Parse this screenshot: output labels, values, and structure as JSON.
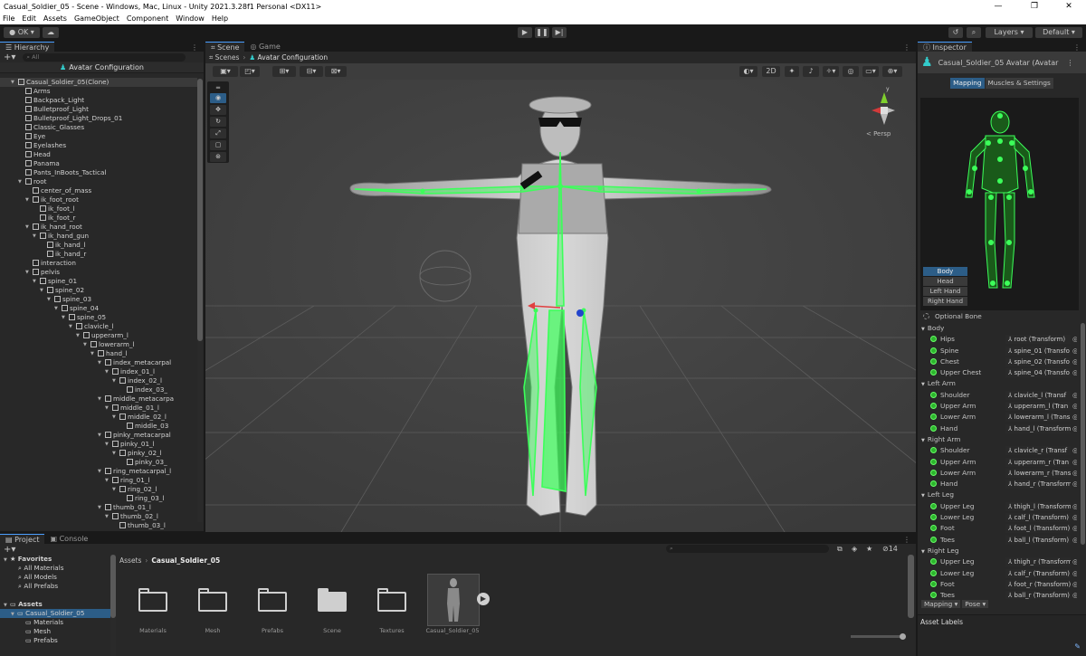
{
  "window": {
    "title": "Casual_Soldier_05 - Scene - Windows, Mac, Linux - Unity 2021.3.28f1 Personal <DX11>",
    "controls": [
      "—",
      "❐",
      "✕"
    ]
  },
  "menu": [
    "File",
    "Edit",
    "Assets",
    "GameObject",
    "Component",
    "Window",
    "Help"
  ],
  "toolbar": {
    "account": "OK",
    "layers": "Layers",
    "layout": "Default"
  },
  "hierarchy": {
    "tab": "Hierarchy",
    "search_placeholder": "All",
    "header": "Avatar Configuration",
    "items": [
      {
        "label": "Casual_Soldier_05(Clone)",
        "depth": 0,
        "fold": "▼"
      },
      {
        "label": "Arms",
        "depth": 1,
        "fold": ""
      },
      {
        "label": "Backpack_Light",
        "depth": 1,
        "fold": ""
      },
      {
        "label": "Bulletproof_Light",
        "depth": 1,
        "fold": ""
      },
      {
        "label": "Bulletproof_Light_Drops_01",
        "depth": 1,
        "fold": ""
      },
      {
        "label": "Classic_Glasses",
        "depth": 1,
        "fold": ""
      },
      {
        "label": "Eye",
        "depth": 1,
        "fold": ""
      },
      {
        "label": "Eyelashes",
        "depth": 1,
        "fold": ""
      },
      {
        "label": "Head",
        "depth": 1,
        "fold": ""
      },
      {
        "label": "Panama",
        "depth": 1,
        "fold": ""
      },
      {
        "label": "Pants_InBoots_Tactical",
        "depth": 1,
        "fold": ""
      },
      {
        "label": "root",
        "depth": 1,
        "fold": "▼"
      },
      {
        "label": "center_of_mass",
        "depth": 2,
        "fold": ""
      },
      {
        "label": "ik_foot_root",
        "depth": 2,
        "fold": "▼"
      },
      {
        "label": "ik_foot_l",
        "depth": 3,
        "fold": ""
      },
      {
        "label": "ik_foot_r",
        "depth": 3,
        "fold": ""
      },
      {
        "label": "ik_hand_root",
        "depth": 2,
        "fold": "▼"
      },
      {
        "label": "ik_hand_gun",
        "depth": 3,
        "fold": "▼"
      },
      {
        "label": "ik_hand_l",
        "depth": 4,
        "fold": ""
      },
      {
        "label": "ik_hand_r",
        "depth": 4,
        "fold": ""
      },
      {
        "label": "interaction",
        "depth": 2,
        "fold": ""
      },
      {
        "label": "pelvis",
        "depth": 2,
        "fold": "▼"
      },
      {
        "label": "spine_01",
        "depth": 3,
        "fold": "▼"
      },
      {
        "label": "spine_02",
        "depth": 4,
        "fold": "▼"
      },
      {
        "label": "spine_03",
        "depth": 5,
        "fold": "▼"
      },
      {
        "label": "spine_04",
        "depth": 6,
        "fold": "▼"
      },
      {
        "label": "spine_05",
        "depth": 7,
        "fold": "▼"
      },
      {
        "label": "clavicle_l",
        "depth": 8,
        "fold": "▼"
      },
      {
        "label": "upperarm_l",
        "depth": 9,
        "fold": "▼"
      },
      {
        "label": "lowerarm_l",
        "depth": 10,
        "fold": "▼"
      },
      {
        "label": "hand_l",
        "depth": 11,
        "fold": "▼"
      },
      {
        "label": "index_metacarpal",
        "depth": 12,
        "fold": "▼"
      },
      {
        "label": "index_01_l",
        "depth": 13,
        "fold": "▼"
      },
      {
        "label": "index_02_l",
        "depth": 14,
        "fold": "▼"
      },
      {
        "label": "index_03_",
        "depth": 15,
        "fold": ""
      },
      {
        "label": "middle_metacarpa",
        "depth": 12,
        "fold": "▼"
      },
      {
        "label": "middle_01_l",
        "depth": 13,
        "fold": "▼"
      },
      {
        "label": "middle_02_l",
        "depth": 14,
        "fold": "▼"
      },
      {
        "label": "middle_03",
        "depth": 15,
        "fold": ""
      },
      {
        "label": "pinky_metacarpal",
        "depth": 12,
        "fold": "▼"
      },
      {
        "label": "pinky_01_l",
        "depth": 13,
        "fold": "▼"
      },
      {
        "label": "pinky_02_l",
        "depth": 14,
        "fold": "▼"
      },
      {
        "label": "pinky_03_",
        "depth": 15,
        "fold": ""
      },
      {
        "label": "ring_metacarpal_l",
        "depth": 12,
        "fold": "▼"
      },
      {
        "label": "ring_01_l",
        "depth": 13,
        "fold": "▼"
      },
      {
        "label": "ring_02_l",
        "depth": 14,
        "fold": "▼"
      },
      {
        "label": "ring_03_l",
        "depth": 15,
        "fold": ""
      },
      {
        "label": "thumb_01_l",
        "depth": 12,
        "fold": "▼"
      },
      {
        "label": "thumb_02_l",
        "depth": 13,
        "fold": "▼"
      },
      {
        "label": "thumb_03_l",
        "depth": 14,
        "fold": ""
      }
    ]
  },
  "scene": {
    "tabs": [
      "Scene",
      "Game"
    ],
    "breadcrumb_root": "Scenes",
    "breadcrumb_current": "Avatar Configuration",
    "toggle_2d": "2D",
    "persp": "< Persp"
  },
  "inspector": {
    "tab": "Inspector",
    "title": "Casual_Soldier_05 Avatar (Avatar",
    "subtabs": [
      "Mapping",
      "Muscles & Settings"
    ],
    "body_buttons": [
      "Body",
      "Head",
      "Left Hand",
      "Right Hand"
    ],
    "optional_bone": "Optional Bone",
    "sections": [
      {
        "name": "Body",
        "bones": [
          {
            "label": "Hips",
            "value": "root (Transform)"
          },
          {
            "label": "Spine",
            "value": "spine_01 (Transfo"
          },
          {
            "label": "Chest",
            "value": "spine_02 (Transfo"
          },
          {
            "label": "Upper Chest",
            "value": "spine_04 (Transfo"
          }
        ]
      },
      {
        "name": "Left Arm",
        "bones": [
          {
            "label": "Shoulder",
            "value": "clavicle_l (Transf"
          },
          {
            "label": "Upper Arm",
            "value": "upperarm_l (Tran"
          },
          {
            "label": "Lower Arm",
            "value": "lowerarm_l (Trans"
          },
          {
            "label": "Hand",
            "value": "hand_l (Transform"
          }
        ]
      },
      {
        "name": "Right Arm",
        "bones": [
          {
            "label": "Shoulder",
            "value": "clavicle_r (Transf"
          },
          {
            "label": "Upper Arm",
            "value": "upperarm_r (Tran"
          },
          {
            "label": "Lower Arm",
            "value": "lowerarm_r (Trans"
          },
          {
            "label": "Hand",
            "value": "hand_r (Transform"
          }
        ]
      },
      {
        "name": "Left Leg",
        "bones": [
          {
            "label": "Upper Leg",
            "value": "thigh_l (Transform"
          },
          {
            "label": "Lower Leg",
            "value": "calf_l (Transform)"
          },
          {
            "label": "Foot",
            "value": "foot_l (Transform)"
          },
          {
            "label": "Toes",
            "value": "ball_l (Transform)"
          }
        ]
      },
      {
        "name": "Right Leg",
        "bones": [
          {
            "label": "Upper Leg",
            "value": "thigh_r (Transform"
          },
          {
            "label": "Lower Leg",
            "value": "calf_r (Transform)"
          },
          {
            "label": "Foot",
            "value": "foot_r (Transform)"
          },
          {
            "label": "Toes",
            "value": "ball_r (Transform)"
          }
        ]
      }
    ],
    "footer_mapping": "Mapping ▾",
    "footer_pose": "Pose ▾",
    "asset_labels": "Asset Labels"
  },
  "project": {
    "tabs": [
      "Project",
      "Console"
    ],
    "favorites": "Favorites",
    "fav_items": [
      "All Materials",
      "All Models",
      "All Prefabs"
    ],
    "assets_root": "Assets",
    "tree": [
      "Casual_Soldier_05",
      "Materials",
      "Mesh",
      "Prefabs"
    ],
    "breadcrumb_root": "Assets",
    "breadcrumb_current": "Casual_Soldier_05",
    "hidden_count": "14",
    "assets": [
      "Materials",
      "Mesh",
      "Prefabs",
      "Scene",
      "Textures",
      "Casual_Soldier_05"
    ]
  },
  "colors": {
    "accent": "#2c5d87",
    "bone_green": "#3cff5a",
    "scene_bg": "#444444"
  }
}
